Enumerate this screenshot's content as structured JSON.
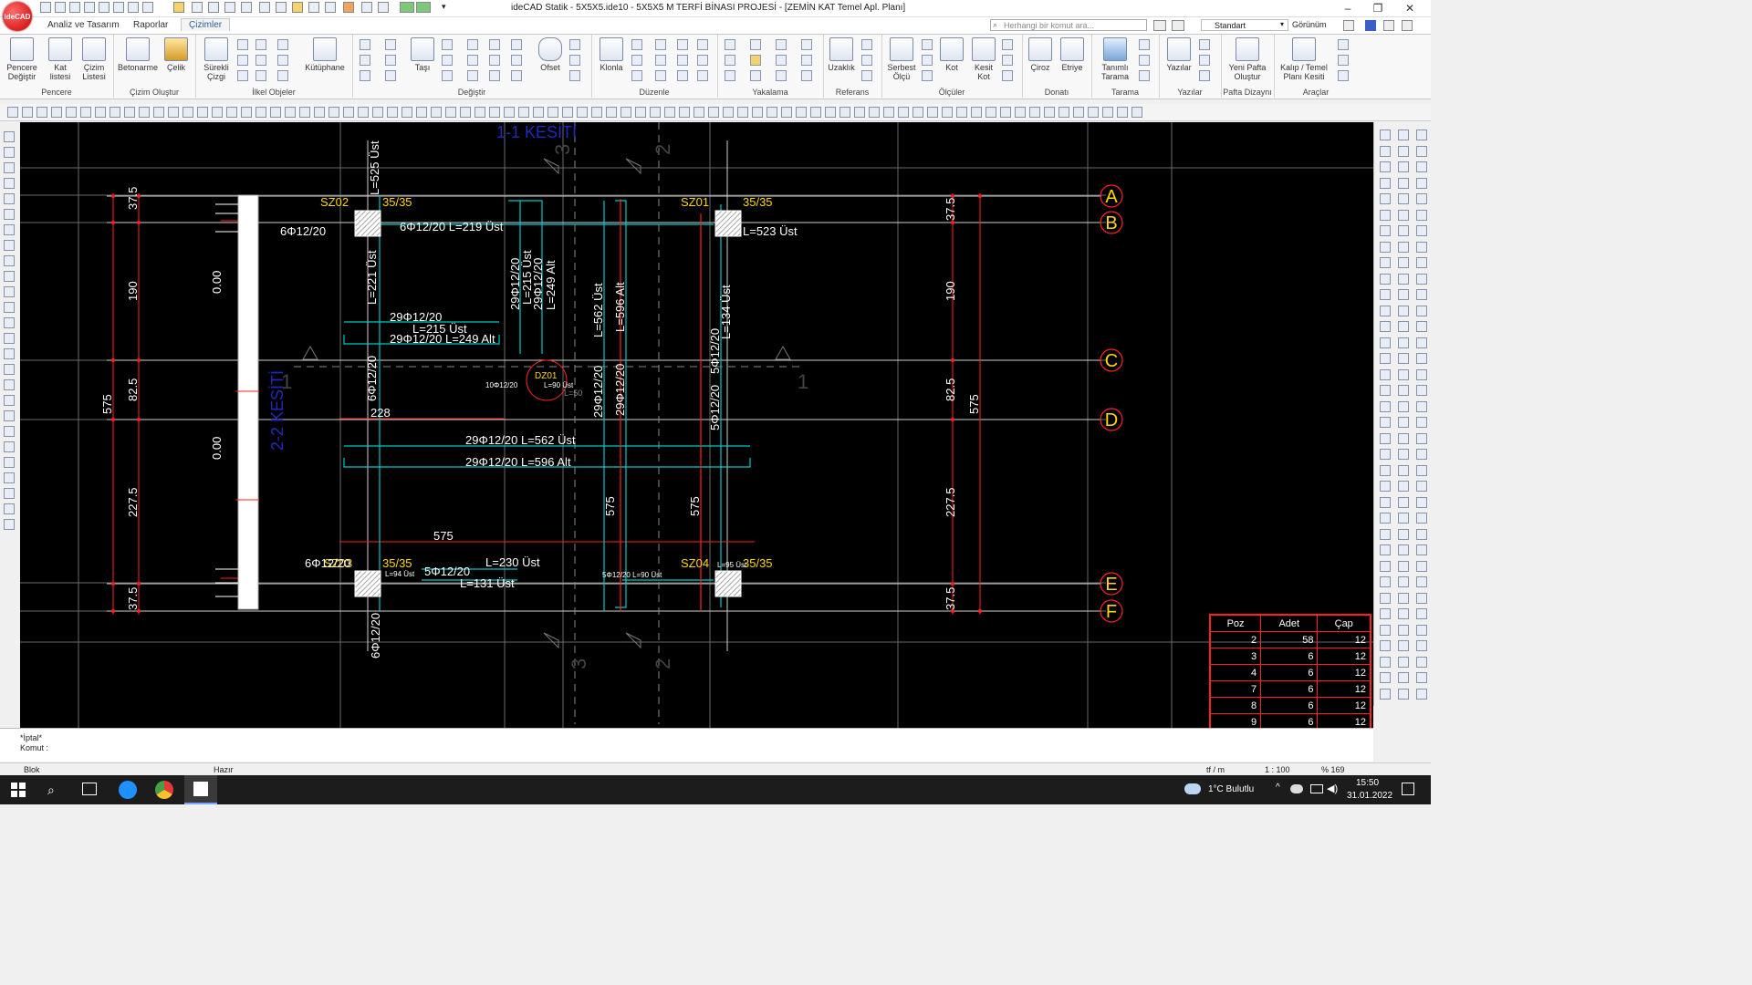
{
  "app": {
    "logo": "ideCAD",
    "title": "ideCAD Statik - 5X5X5.ide10 - 5X5X5 M TERFİ BİNASI PROJESİ - [ZEMİN KAT Temel Apl. Planı]",
    "window_controls": [
      "–",
      "❐",
      "✕"
    ]
  },
  "tabs": [
    {
      "label": "Analiz ve Tasarım"
    },
    {
      "label": "Raporlar"
    },
    {
      "label": "Çizimler",
      "active": true
    }
  ],
  "search": {
    "placeholder": "Herhangi bir komut ara..."
  },
  "style_select": {
    "value": "Standart"
  },
  "view_menu": {
    "label": "Görünüm"
  },
  "ribbon": {
    "groups": [
      {
        "title": "Pencere",
        "buttons": [
          "Pencere Değiştir",
          "Kat listesi",
          "Çizim Listesi"
        ]
      },
      {
        "title": "Çizim Oluştur",
        "buttons": [
          "Betonarme",
          "Çelik"
        ]
      },
      {
        "title": "İlkel Objeler",
        "buttons": [
          "Sürekli Çizgi",
          "Kütüphane"
        ]
      },
      {
        "title": "Değiştir",
        "buttons": [
          "Taşı",
          "Ofset"
        ]
      },
      {
        "title": "Düzenle",
        "buttons": [
          "Klonla"
        ]
      },
      {
        "title": "Yakalama",
        "buttons": []
      },
      {
        "title": "Referans",
        "buttons": [
          "Uzaklık"
        ]
      },
      {
        "title": "Ölçüler",
        "buttons": [
          "Serbest Ölçü",
          "Kot",
          "Kesit Kot"
        ]
      },
      {
        "title": "Donatı",
        "buttons": [
          "Çiroz",
          "Etriye"
        ]
      },
      {
        "title": "Tarama",
        "buttons": [
          "Tanımlı Tarama"
        ]
      },
      {
        "title": "Yazılar",
        "buttons": [
          "Yazılar"
        ]
      },
      {
        "title": "Pafta Dizaynı",
        "buttons": [
          "Yeni Pafta Oluştur"
        ]
      },
      {
        "title": "Araçlar",
        "buttons": [
          "Kalıp / Temel Planı Kesiti"
        ]
      }
    ]
  },
  "drawing": {
    "section_1": "1-1 KESİTİ",
    "section_2": "2-2 KESİTİ",
    "axes": [
      "A",
      "B",
      "C",
      "D",
      "E",
      "F"
    ],
    "columns": [
      "SZ02",
      "SZ01",
      "SZ03",
      "SZ04"
    ],
    "column_size": "35/35",
    "beam": "DZ01",
    "dims_left": [
      "37.5",
      "190",
      "82.5",
      "227.5",
      "37.5",
      "575"
    ],
    "dims_right": [
      "37.5",
      "190",
      "82.5",
      "227.5",
      "37.5",
      "575"
    ],
    "levels": [
      "0.00",
      "0.00"
    ],
    "labels": {
      "l525": "L=525 Üst",
      "l221": "L=221 Üst",
      "bar6_12_20": "6Φ12/20",
      "l219": "6Φ12/20     L=219 Üst",
      "l523": "L=523 Üst",
      "b29a": "29Φ12/20",
      "l215": "L=215 Üst",
      "l249": "29Φ12/20 L=249 Alt",
      "b29v1": "29Φ12/20",
      "l215v": "L=215 Üst",
      "b29v2": "29Φ12/20",
      "l249v": "L=249 Alt",
      "l562v": "L=562 Üst",
      "l596v": "L=596 Alt",
      "b29d1": "29Φ12/20",
      "b29d2": "29Φ12/20",
      "l134": "L=134 Üst",
      "b5a": "5Φ12/20",
      "b5b": "5Φ12/20",
      "h228": "228",
      "l562": "29Φ12/20    L=562 Üst",
      "l596": "29Φ12/20    L=596 Alt",
      "h575": "575",
      "v575a": "575",
      "v575b": "575",
      "l230": "L=230 Üst",
      "b5c": "5Φ12/20",
      "l131": "L=131 Üst",
      "l94": "L=94 Üst",
      "l95": "L=95 Üst",
      "l90": "5Φ12/20     L=90 Üst",
      "b6bottom": "6Φ12/20",
      "dz_small1": "10Φ12/20",
      "dz_small2": "L=90 Üst",
      "dz_small3": "L=50"
    }
  },
  "poz_table": {
    "headers": [
      "Poz",
      "Adet",
      "Çap"
    ],
    "rows": [
      [
        "2",
        "58",
        "12"
      ],
      [
        "3",
        "6",
        "12"
      ],
      [
        "4",
        "6",
        "12"
      ],
      [
        "7",
        "6",
        "12"
      ],
      [
        "8",
        "6",
        "12"
      ],
      [
        "9",
        "6",
        "12"
      ]
    ]
  },
  "command": {
    "line1": "*İptal*",
    "line2": "Komut :"
  },
  "status": {
    "mode": "Blok",
    "state": "Hazır",
    "unit": "tf / m",
    "scale": "1 : 100",
    "zoom": "% 169"
  },
  "taskbar": {
    "weather": "1°C  Bulutlu",
    "time": "15:50",
    "date": "31.01.2022"
  },
  "colors": {
    "accent": "#2a5d9c",
    "rebar": "#00c8c8",
    "dim": "#ff2020",
    "column_label": "#ffd700",
    "section": "#2020c8"
  }
}
